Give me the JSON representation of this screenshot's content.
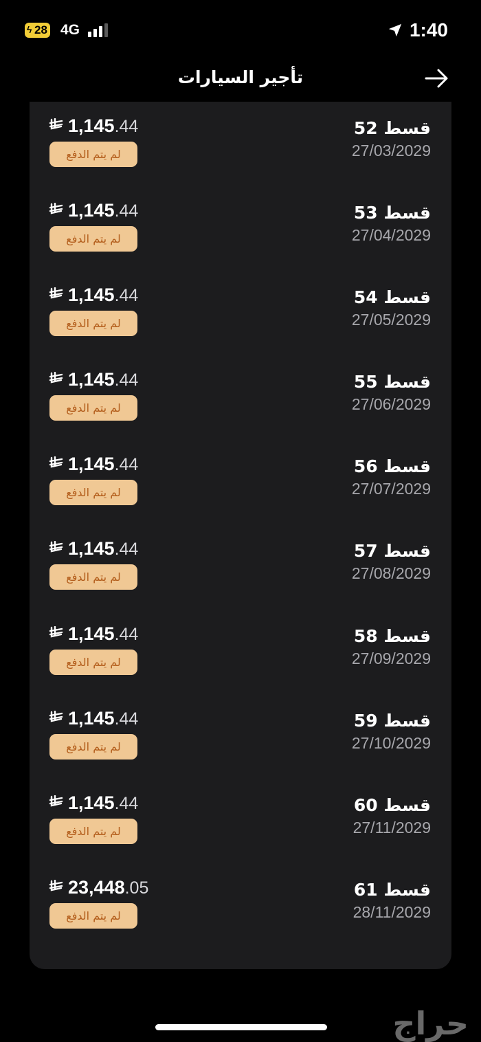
{
  "status_bar": {
    "battery": "28",
    "network": "4G",
    "time": "1:40"
  },
  "header": {
    "title": "تأجير السيارات"
  },
  "installments": [
    {
      "label": "قسط 52",
      "date": "27/03/2029",
      "amount_int": "1,145",
      "amount_dec": ".44",
      "status": "لم يتم الدفع"
    },
    {
      "label": "قسط 53",
      "date": "27/04/2029",
      "amount_int": "1,145",
      "amount_dec": ".44",
      "status": "لم يتم الدفع"
    },
    {
      "label": "قسط 54",
      "date": "27/05/2029",
      "amount_int": "1,145",
      "amount_dec": ".44",
      "status": "لم يتم الدفع"
    },
    {
      "label": "قسط 55",
      "date": "27/06/2029",
      "amount_int": "1,145",
      "amount_dec": ".44",
      "status": "لم يتم الدفع"
    },
    {
      "label": "قسط 56",
      "date": "27/07/2029",
      "amount_int": "1,145",
      "amount_dec": ".44",
      "status": "لم يتم الدفع"
    },
    {
      "label": "قسط 57",
      "date": "27/08/2029",
      "amount_int": "1,145",
      "amount_dec": ".44",
      "status": "لم يتم الدفع"
    },
    {
      "label": "قسط 58",
      "date": "27/09/2029",
      "amount_int": "1,145",
      "amount_dec": ".44",
      "status": "لم يتم الدفع"
    },
    {
      "label": "قسط 59",
      "date": "27/10/2029",
      "amount_int": "1,145",
      "amount_dec": ".44",
      "status": "لم يتم الدفع"
    },
    {
      "label": "قسط 60",
      "date": "27/11/2029",
      "amount_int": "1,145",
      "amount_dec": ".44",
      "status": "لم يتم الدفع"
    },
    {
      "label": "قسط 61",
      "date": "28/11/2029",
      "amount_int": "23,448",
      "amount_dec": ".05",
      "status": "لم يتم الدفع"
    }
  ],
  "currency_symbol": "⃁",
  "watermark": "حراج",
  "colors": {
    "background": "#000000",
    "card": "#1c1c1e",
    "badge_bg": "#f0c894",
    "badge_text": "#b35d1b",
    "battery": "#f2cd37"
  }
}
